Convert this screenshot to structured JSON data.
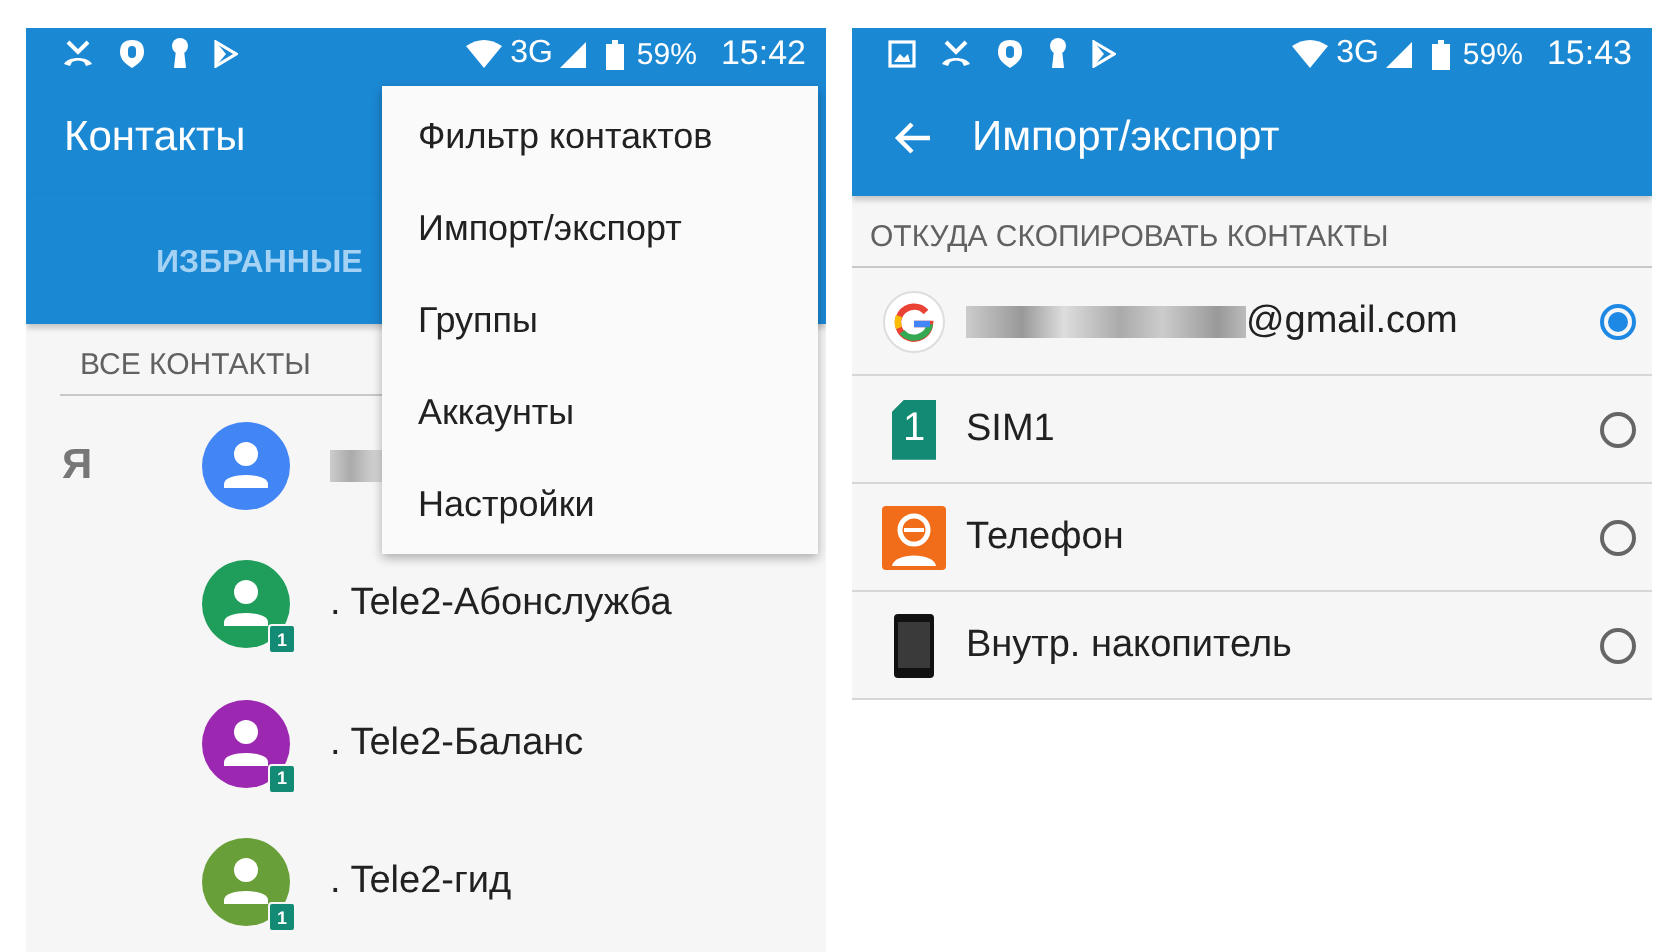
{
  "screens": [
    {
      "kind": "contacts",
      "status_bar": {
        "notification_icons": [
          {
            "kind": "missed-call"
          },
          {
            "kind": "shield"
          },
          {
            "kind": "keyhole"
          },
          {
            "kind": "play"
          }
        ],
        "network": "3G",
        "battery": "59%",
        "time": "15:42"
      },
      "title": "Контакты",
      "tabs": [
        {
          "label": "ИЗБРАННЫЕ",
          "selected": false
        }
      ],
      "section": "ВСЕ КОНТАКТЫ",
      "contacts": [
        {
          "index_letter": "Я",
          "name_redacted": true,
          "color": "#4285f4"
        },
        {
          "name": ". Tele2-Абонслужба",
          "color": "#1e9e5a",
          "sim_badge": "1"
        },
        {
          "name": ". Tele2-Баланс",
          "color": "#9c27b0",
          "sim_badge": "1"
        },
        {
          "name": ". Tele2-гид",
          "color": "#689f38",
          "sim_badge": "1"
        }
      ],
      "menu": [
        "Фильтр контактов",
        "Импорт/экспорт",
        "Группы",
        "Аккаунты",
        "Настройки"
      ]
    },
    {
      "kind": "import",
      "status_bar": {
        "notification_icons": [
          {
            "kind": "image"
          },
          {
            "kind": "missed-call"
          },
          {
            "kind": "shield"
          },
          {
            "kind": "keyhole"
          },
          {
            "kind": "play"
          }
        ],
        "network": "3G",
        "battery": "59%",
        "time": "15:43"
      },
      "title": "Импорт/экспорт",
      "section": "ОТКУДА СКОПИРОВАТЬ КОНТАКТЫ",
      "sources": [
        {
          "kind": "google",
          "label": "@gmail.com",
          "redacted_prefix": true,
          "selected": true
        },
        {
          "kind": "sim",
          "badge": "1",
          "label": "SIM1",
          "selected": false
        },
        {
          "kind": "phone",
          "label": "Телефон",
          "selected": false
        },
        {
          "kind": "storage",
          "label": "Внутр. накопитель",
          "selected": false
        }
      ]
    }
  ]
}
